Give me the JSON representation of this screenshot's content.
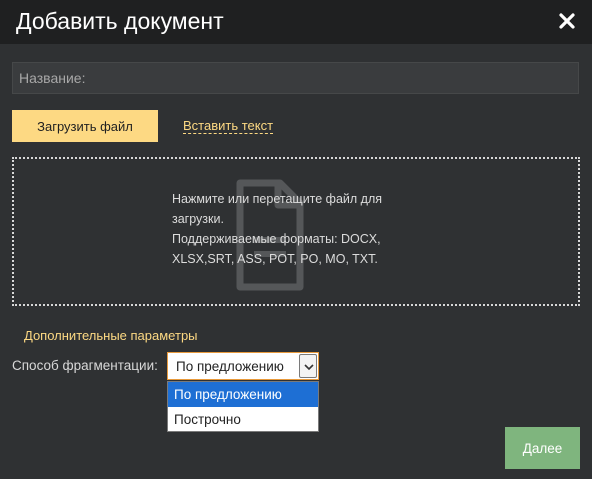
{
  "dialog": {
    "title": "Добавить документ",
    "close_icon": "close-icon"
  },
  "name_field": {
    "placeholder": "Название:",
    "value": ""
  },
  "upload": {
    "button_label": "Загрузить файл",
    "link_label": "Вставить текст"
  },
  "dropzone": {
    "icon": "document-icon",
    "lines": [
      "Нажмите или перетащите файл для",
      "загрузки.",
      "Поддерживаемые форматы: DOCX,",
      "XLSX,SRT, ASS, POT, PO, MO, TXT."
    ]
  },
  "advanced": {
    "title": "Дополнительные параметры",
    "fragmentation_label": "Способ фрагментации:",
    "selected": "По предложению",
    "options": [
      "По предложению",
      "Построчно"
    ]
  },
  "footer": {
    "next_label": "Далее"
  },
  "colors": {
    "accent_yellow": "#fdd983",
    "next_button": "#7fb57e",
    "selected_option": "#1e6fd4",
    "background": "#2f3133",
    "header": "#1f2021"
  }
}
